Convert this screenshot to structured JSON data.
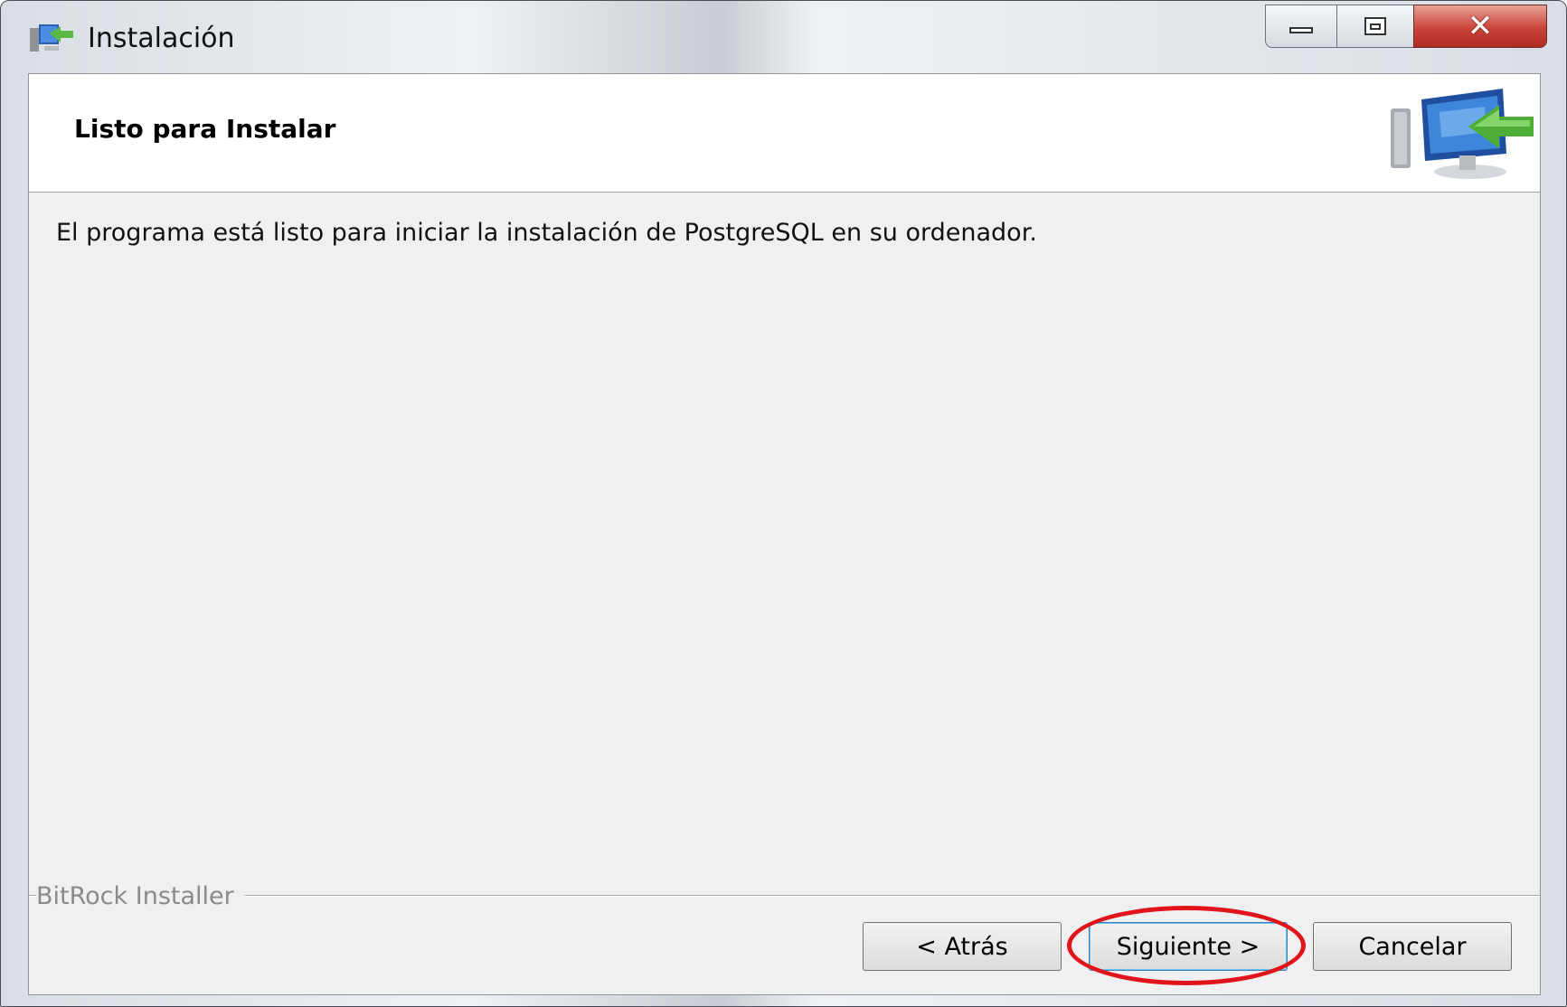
{
  "window": {
    "title": "Instalación",
    "controls": {
      "minimize": "minimize-icon",
      "maximize": "maximize-icon",
      "close": "close-icon"
    }
  },
  "header": {
    "title": "Listo para Instalar",
    "icon": "computer-install-icon"
  },
  "body": {
    "message": "El programa está listo para iniciar la instalación de PostgreSQL en su ordenador."
  },
  "footer": {
    "group_label": "BitRock Installer",
    "buttons": {
      "back": "< Atrás",
      "next": "Siguiente >",
      "cancel": "Cancelar"
    }
  },
  "annotation": {
    "highlight_color": "#e0141a"
  }
}
